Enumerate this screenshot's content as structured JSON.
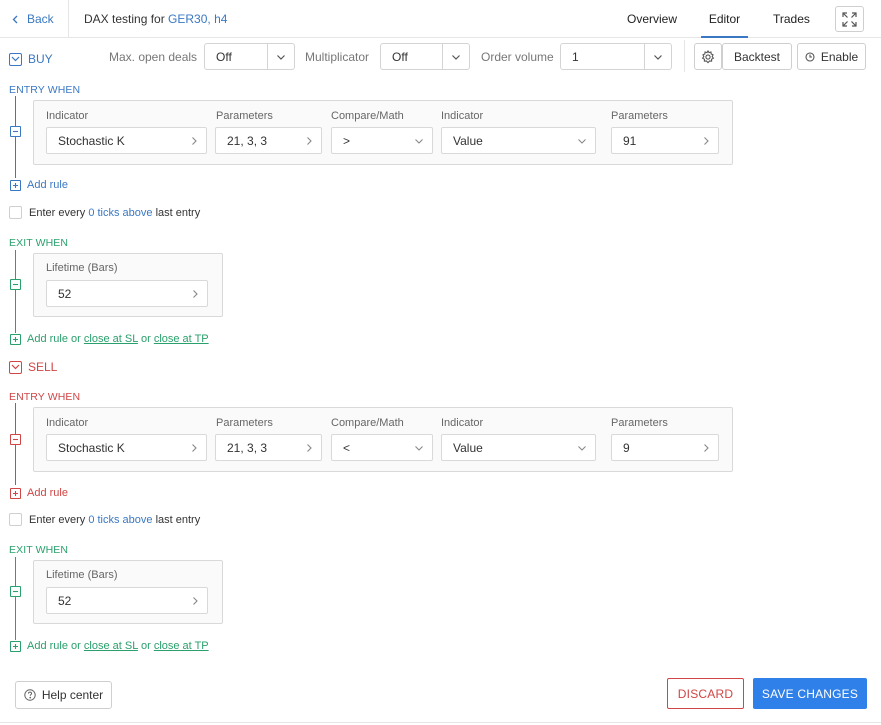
{
  "header": {
    "back_label": "Back",
    "title_prefix": "DAX testing for ",
    "title_link": "GER30, h4",
    "tabs": [
      {
        "label": "Overview",
        "active": false
      },
      {
        "label": "Editor",
        "active": true
      },
      {
        "label": "Trades",
        "active": false
      }
    ],
    "fullscreen_icon": "expand-icon"
  },
  "toolbar": {
    "buy_label": "BUY",
    "max_open_deals_label": "Max. open deals",
    "max_open_deals_value": "Off",
    "multiplicator_label": "Multiplicator",
    "multiplicator_value": "Off",
    "order_volume_label": "Order volume",
    "order_volume_value": "1",
    "settings_icon": "gear-icon",
    "backtest_label": "Backtest",
    "enable_label": "Enable"
  },
  "buy": {
    "entry_title": "ENTRY WHEN",
    "entry_rule": {
      "labels": [
        "Indicator",
        "Parameters",
        "Compare/Math",
        "Indicator",
        "Parameters"
      ],
      "indicator": "Stochastic K",
      "parameters": "21, 3, 3",
      "compare": ">",
      "indicator2": "Value",
      "parameters2": "91"
    },
    "add_rule": "Add rule",
    "enter_every": {
      "prefix": "Enter every ",
      "link": "0 ticks above",
      "suffix": " last entry"
    },
    "exit_title": "EXIT WHEN",
    "exit_rule": {
      "label": "Lifetime (Bars)",
      "value": "52"
    },
    "exit_add": {
      "add_rule": "Add rule",
      "or1": " or ",
      "close_sl": "close at SL",
      "or2": " or ",
      "close_tp": "close at TP"
    }
  },
  "sell": {
    "label": "SELL",
    "entry_title": "ENTRY WHEN",
    "entry_rule": {
      "labels": [
        "Indicator",
        "Parameters",
        "Compare/Math",
        "Indicator",
        "Parameters"
      ],
      "indicator": "Stochastic K",
      "parameters": "21, 3, 3",
      "compare": "<",
      "indicator2": "Value",
      "parameters2": "9"
    },
    "add_rule": "Add rule",
    "enter_every": {
      "prefix": "Enter every ",
      "link": "0 ticks above",
      "suffix": " last entry"
    },
    "exit_title": "EXIT WHEN",
    "exit_rule": {
      "label": "Lifetime (Bars)",
      "value": "52"
    },
    "exit_add": {
      "add_rule": "Add rule",
      "or1": " or ",
      "close_sl": "close at SL",
      "or2": " or ",
      "close_tp": "close at TP"
    }
  },
  "footer": {
    "help_label": "Help center",
    "discard_label": "DISCARD",
    "save_label": "SAVE CHANGES"
  },
  "colors": {
    "accent_blue": "#3a78c3",
    "buy_green": "#2aa06c",
    "sell_red": "#d04545",
    "save_button": "#2f80e8"
  }
}
